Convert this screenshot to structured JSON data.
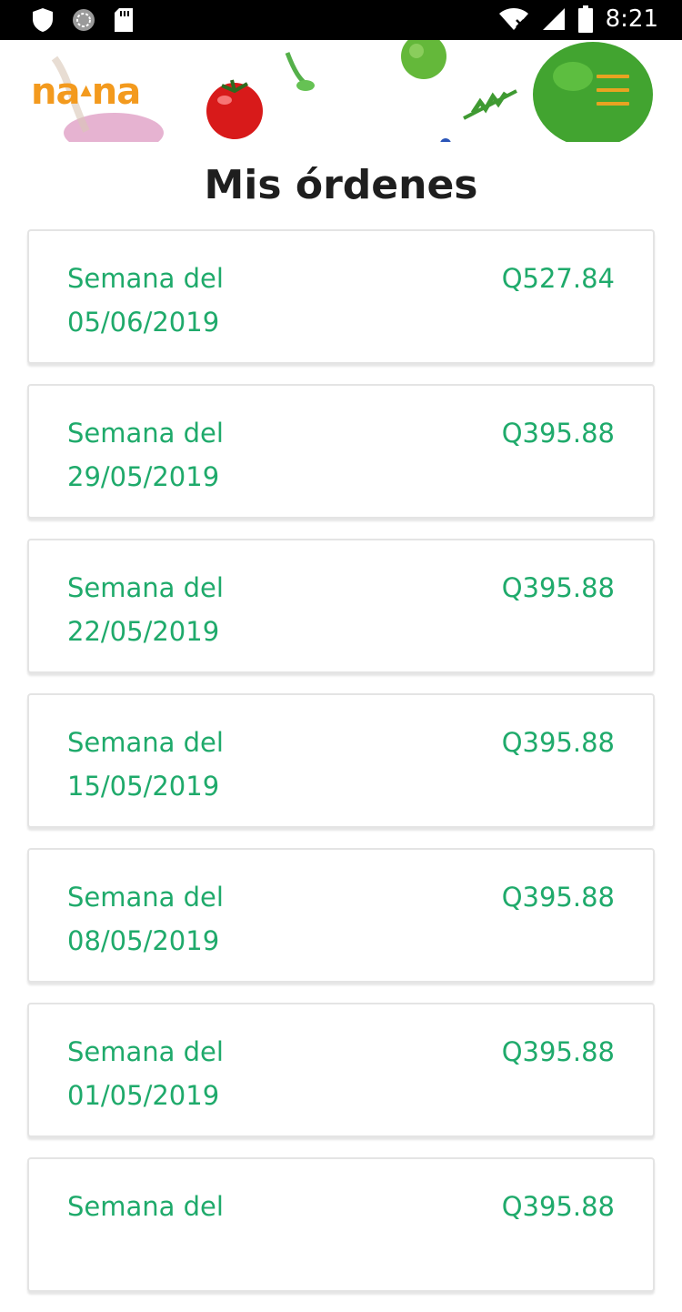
{
  "status_bar": {
    "time": "8:21",
    "icons": [
      "shield-icon",
      "sync-icon",
      "sd-card-icon",
      "wifi-icon",
      "signal-icon",
      "battery-icon"
    ]
  },
  "header": {
    "logo_left": "na",
    "logo_right": "na",
    "menu_icon": "hamburger-menu-icon",
    "accent_color": "#f39a1e"
  },
  "page": {
    "title": "Mis órdenes"
  },
  "orders": [
    {
      "label": "Semana del",
      "date": "05/06/2019",
      "amount": "Q527.84"
    },
    {
      "label": "Semana del",
      "date": "29/05/2019",
      "amount": "Q395.88"
    },
    {
      "label": "Semana del",
      "date": "22/05/2019",
      "amount": "Q395.88"
    },
    {
      "label": "Semana del",
      "date": "15/05/2019",
      "amount": "Q395.88"
    },
    {
      "label": "Semana del",
      "date": "08/05/2019",
      "amount": "Q395.88"
    },
    {
      "label": "Semana del",
      "date": "01/05/2019",
      "amount": "Q395.88"
    },
    {
      "label": "Semana del",
      "date": "",
      "amount": "Q395.88"
    }
  ],
  "colors": {
    "order_text": "#1faa6b",
    "title_text": "#1e1e1e"
  }
}
